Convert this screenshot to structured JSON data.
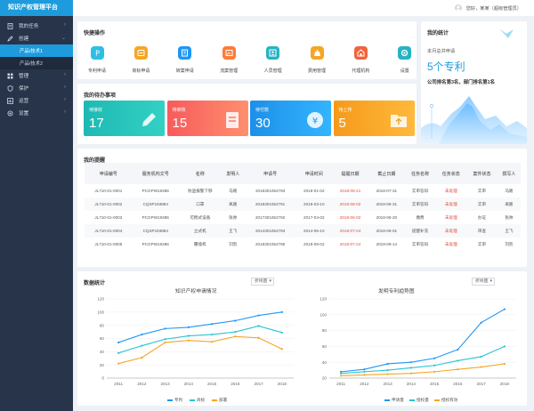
{
  "app": {
    "title": "知识产权管理平台",
    "user": "您好，某某（超级管理员）"
  },
  "sidebar": {
    "items": [
      {
        "label": "我的任务",
        "icon": "doc-icon"
      },
      {
        "label": "创建",
        "icon": "edit-icon"
      },
      {
        "label": "管理",
        "icon": "grid-icon"
      },
      {
        "label": "保护",
        "icon": "shield-icon"
      },
      {
        "label": "运营",
        "icon": "chart-icon"
      },
      {
        "label": "设置",
        "icon": "gear-icon"
      }
    ],
    "subs": [
      "产品/技术1",
      "产品/技术2"
    ]
  },
  "quick": {
    "title": "快捷操作",
    "items": [
      {
        "label": "专利申请",
        "color": "#2dbfe6"
      },
      {
        "label": "商标申请",
        "color": "#f5a623"
      },
      {
        "label": "转案申请",
        "color": "#2196f3"
      },
      {
        "label": "流案管理",
        "color": "#ff7b3a"
      },
      {
        "label": "人员管理",
        "color": "#26b3c4"
      },
      {
        "label": "费用管理",
        "color": "#f5a623"
      },
      {
        "label": "代理机构",
        "color": "#f0643e"
      },
      {
        "label": "设置",
        "color": "#26b3c4"
      }
    ]
  },
  "stats": {
    "title": "我的统计",
    "line1": "本月总共申请",
    "big": "5个专利",
    "line2": "公司排名第3名，部门排名第1名"
  },
  "todo": {
    "title": "我的待办事项",
    "items": [
      {
        "label": "待接收",
        "count": "17",
        "from": "#1fb9b3",
        "to": "#32d1c4"
      },
      {
        "label": "待审核",
        "count": "15",
        "from": "#f75b5b",
        "to": "#ff8f6e"
      },
      {
        "label": "待付款",
        "count": "30",
        "from": "#1d8fe8",
        "to": "#33b5ff"
      },
      {
        "label": "待上传",
        "count": "5",
        "from": "#f59a1b",
        "to": "#ffb93b"
      }
    ]
  },
  "reminders": {
    "title": "我的提醒",
    "headers": [
      "申请编号",
      "服务机构文号",
      "名称",
      "发明人",
      "申请号",
      "申请时间",
      "提醒日期",
      "截止日期",
      "任务名称",
      "任务状态",
      "案件状态",
      "撰写人"
    ],
    "rows": [
      [
        "JL710-01-0001",
        "PCGPW19386",
        "防盗报警下够",
        "马路",
        "2018301052793",
        "2018-01-02",
        "2018-05-21",
        "2018-07-31",
        "实审答辩",
        "未处理",
        "实审",
        "马路"
      ],
      [
        "JL710-01-0002",
        "CQSP193884",
        "口罩",
        "离路",
        "2018301052791",
        "2018-03-10",
        "2018-06-02",
        "2018-06-31",
        "实审答辩",
        "未处理",
        "实审",
        "离路"
      ],
      [
        "JL710-01-0003",
        "PCGPW19386",
        "可携式设备",
        "张帅",
        "2017301052792",
        "2017-04-02",
        "2018-06-02",
        "2018-06-20",
        "缴费",
        "未处理",
        "办证",
        "张帅"
      ],
      [
        "JL710-01-0004",
        "CQSP193884",
        "立式机",
        "王飞",
        "2014301052793",
        "2014-05-10",
        "2018-07-24",
        "2018-09-01",
        "提醒补充",
        "未处理",
        "审查",
        "王飞"
      ],
      [
        "JL710-01-0005",
        "PCGPW19386",
        "覆缝机",
        "刘凯",
        "2018301052795",
        "2018-06-02",
        "2018-07-24",
        "2018-09-14",
        "实审答辩",
        "未处理",
        "实审",
        "刘凯"
      ]
    ]
  },
  "datastats": {
    "title": "数据统计",
    "dropdown": "折线图"
  },
  "chart_data": [
    {
      "type": "line",
      "title": "知识产权申请情况",
      "x": [
        "2011",
        "2012",
        "2013",
        "2014",
        "2015",
        "2016",
        "2017",
        "2018"
      ],
      "ylim": [
        0,
        120
      ],
      "yticks": [
        "0",
        "20",
        "40",
        "60",
        "80",
        "100",
        "120"
      ],
      "series": [
        {
          "name": "专利",
          "color": "#2196f3",
          "values": [
            54,
            66,
            75,
            77,
            82,
            87,
            95,
            100
          ]
        },
        {
          "name": "商标",
          "color": "#26c4d0",
          "values": [
            38,
            49,
            59,
            64,
            66,
            70,
            79,
            69
          ]
        },
        {
          "name": "部署",
          "color": "#f5a623",
          "values": [
            22,
            31,
            54,
            57,
            55,
            63,
            61,
            44
          ]
        }
      ]
    },
    {
      "type": "line",
      "title": "发明专利趋势图",
      "x": [
        "2011",
        "2012",
        "2013",
        "2014",
        "2015",
        "2016",
        "2017",
        "2018"
      ],
      "ylim": [
        0,
        120
      ],
      "yticks": [
        "20",
        "40",
        "60",
        "80",
        "100",
        "120"
      ],
      "series": [
        {
          "name": "申请量",
          "color": "#2196f3",
          "values": [
            28,
            31,
            38,
            40,
            45,
            56,
            90,
            107
          ]
        },
        {
          "name": "授权量",
          "color": "#26c4d0",
          "values": [
            26,
            28,
            30,
            33,
            36,
            42,
            47,
            60
          ]
        },
        {
          "name": "授权有效",
          "color": "#f5a623",
          "values": [
            23,
            24,
            25,
            26,
            28,
            31,
            34,
            38
          ]
        }
      ]
    }
  ]
}
